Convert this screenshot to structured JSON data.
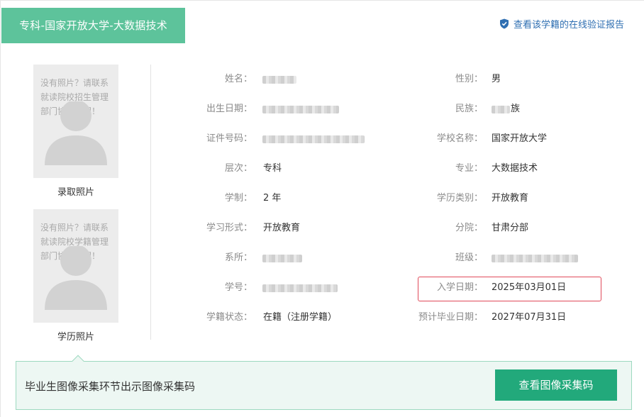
{
  "header": {
    "title": "专科-国家开放大学-大数据技术"
  },
  "verify_link": {
    "label": "查看该学籍的在线验证报告",
    "icon": "shield-check-icon",
    "color": "#2f6fb2"
  },
  "photos": [
    {
      "placeholder": "没有照片？请联系就读院校招生管理部门协助处理！",
      "caption": "录取照片"
    },
    {
      "placeholder": "没有照片？请联系就读院校学籍管理部门协助处理！",
      "caption": "学历照片"
    }
  ],
  "fields_left": [
    {
      "label": "姓名：",
      "value": ""
    },
    {
      "label": "出生日期：",
      "value": ""
    },
    {
      "label": "证件号码：",
      "value": ""
    },
    {
      "label": "层次：",
      "value": "专科"
    },
    {
      "label": "学制：",
      "value": "2 年"
    },
    {
      "label": "学习形式：",
      "value": "开放教育"
    },
    {
      "label": "系所：",
      "value": ""
    },
    {
      "label": "学号：",
      "value": ""
    },
    {
      "label": "学籍状态：",
      "value": "在籍（注册学籍）"
    }
  ],
  "fields_right": [
    {
      "label": "性别：",
      "value": "男"
    },
    {
      "label": "民族：",
      "value": "族"
    },
    {
      "label": "学校名称：",
      "value": "国家开放大学"
    },
    {
      "label": "专业：",
      "value": "大数据技术"
    },
    {
      "label": "学历类别：",
      "value": "开放教育"
    },
    {
      "label": "分院：",
      "value": "甘肃分部"
    },
    {
      "label": "班级：",
      "value": ""
    },
    {
      "label": "入学日期：",
      "value": "2025年03月01日"
    },
    {
      "label": "预计毕业日期：",
      "value": "2027年07月31日"
    }
  ],
  "bottom": {
    "text": "毕业生图像采集环节出示图像采集码",
    "button_label": "查看图像采集码"
  },
  "colors": {
    "accent": "#5dc39b",
    "button": "#22a97b",
    "highlight": "#e04a5a"
  }
}
